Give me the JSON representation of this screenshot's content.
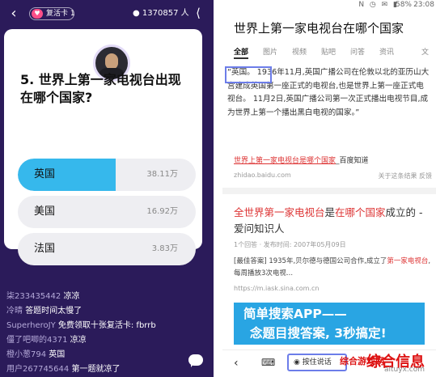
{
  "quiz": {
    "revive_card": "复活卡 1",
    "viewer_count": "1370857 人",
    "question": "5. 世界上第一家电视台出现在哪个国家?",
    "options": [
      {
        "label": "英国",
        "count": "38.11万",
        "fraction": 0.55,
        "selected": true
      },
      {
        "label": "美国",
        "count": "16.92万",
        "fraction": 0,
        "selected": false
      },
      {
        "label": "法国",
        "count": "3.83万",
        "fraction": 0,
        "selected": false
      }
    ],
    "chat": [
      {
        "user": "柒233435442",
        "text": "凉凉"
      },
      {
        "user": "冷晴",
        "text": "答题时间太慢了"
      },
      {
        "user": "SuperheroJY",
        "text": "免费领取十张复活卡: fbrrb"
      },
      {
        "user": "僵了吧唧的4371",
        "text": "凉凉"
      },
      {
        "user": "橙小葱794",
        "text": "英国"
      },
      {
        "user": "用户267745644",
        "text": "第一题就凉了"
      }
    ]
  },
  "search": {
    "status": {
      "battery": "58%",
      "time": "23:08"
    },
    "query": "世界上第一家电视台在哪个国家",
    "tabs": [
      "全部",
      "图片",
      "视频",
      "贴吧",
      "问答",
      "资讯",
      "文"
    ],
    "answer_text": "“英国。 1936年11月,英国广播公司在伦敦以北的亚历山大宫建成英国第一座正式的电视台,也是世界上第一座正式电视台。 11月2日,英国广播公司第一次正式播出电视节目,成为世界上第一个播出黑白电视的国家。”",
    "source_link": "世界上第一家电视台是哪个国家",
    "source_suffix": "_百度知道",
    "source_domain": "zhidao.baidu.com",
    "source_about": "关于这条结果",
    "source_feedback": "反馈",
    "r2_title_red": "全世界第一家电视台",
    "r2_title_mid1": "是",
    "r2_title_red2": "在哪个国家",
    "r2_title_rest": "成立的 - 爱问知识人",
    "r2_meta": "1个回答 · 发布时间: 2007年05月09日",
    "r2_body_pre": "[最佳答案] 1935年,贝尔德与德国公司合作,成立了",
    "r2_body_red": "第一家电视台",
    "r2_body_post": ",每周播放3次电视...",
    "r2_url": "https://m.iask.sina.com.cn",
    "ad_line1": "简单搜索APP——",
    "ad_line2": "念题目搜答案, 3秒搞定!",
    "voice_button": "按住说话",
    "watermark_site": "综合游戏网",
    "watermark_brand": "综合信息",
    "watermark_url": "aituyx.com"
  }
}
